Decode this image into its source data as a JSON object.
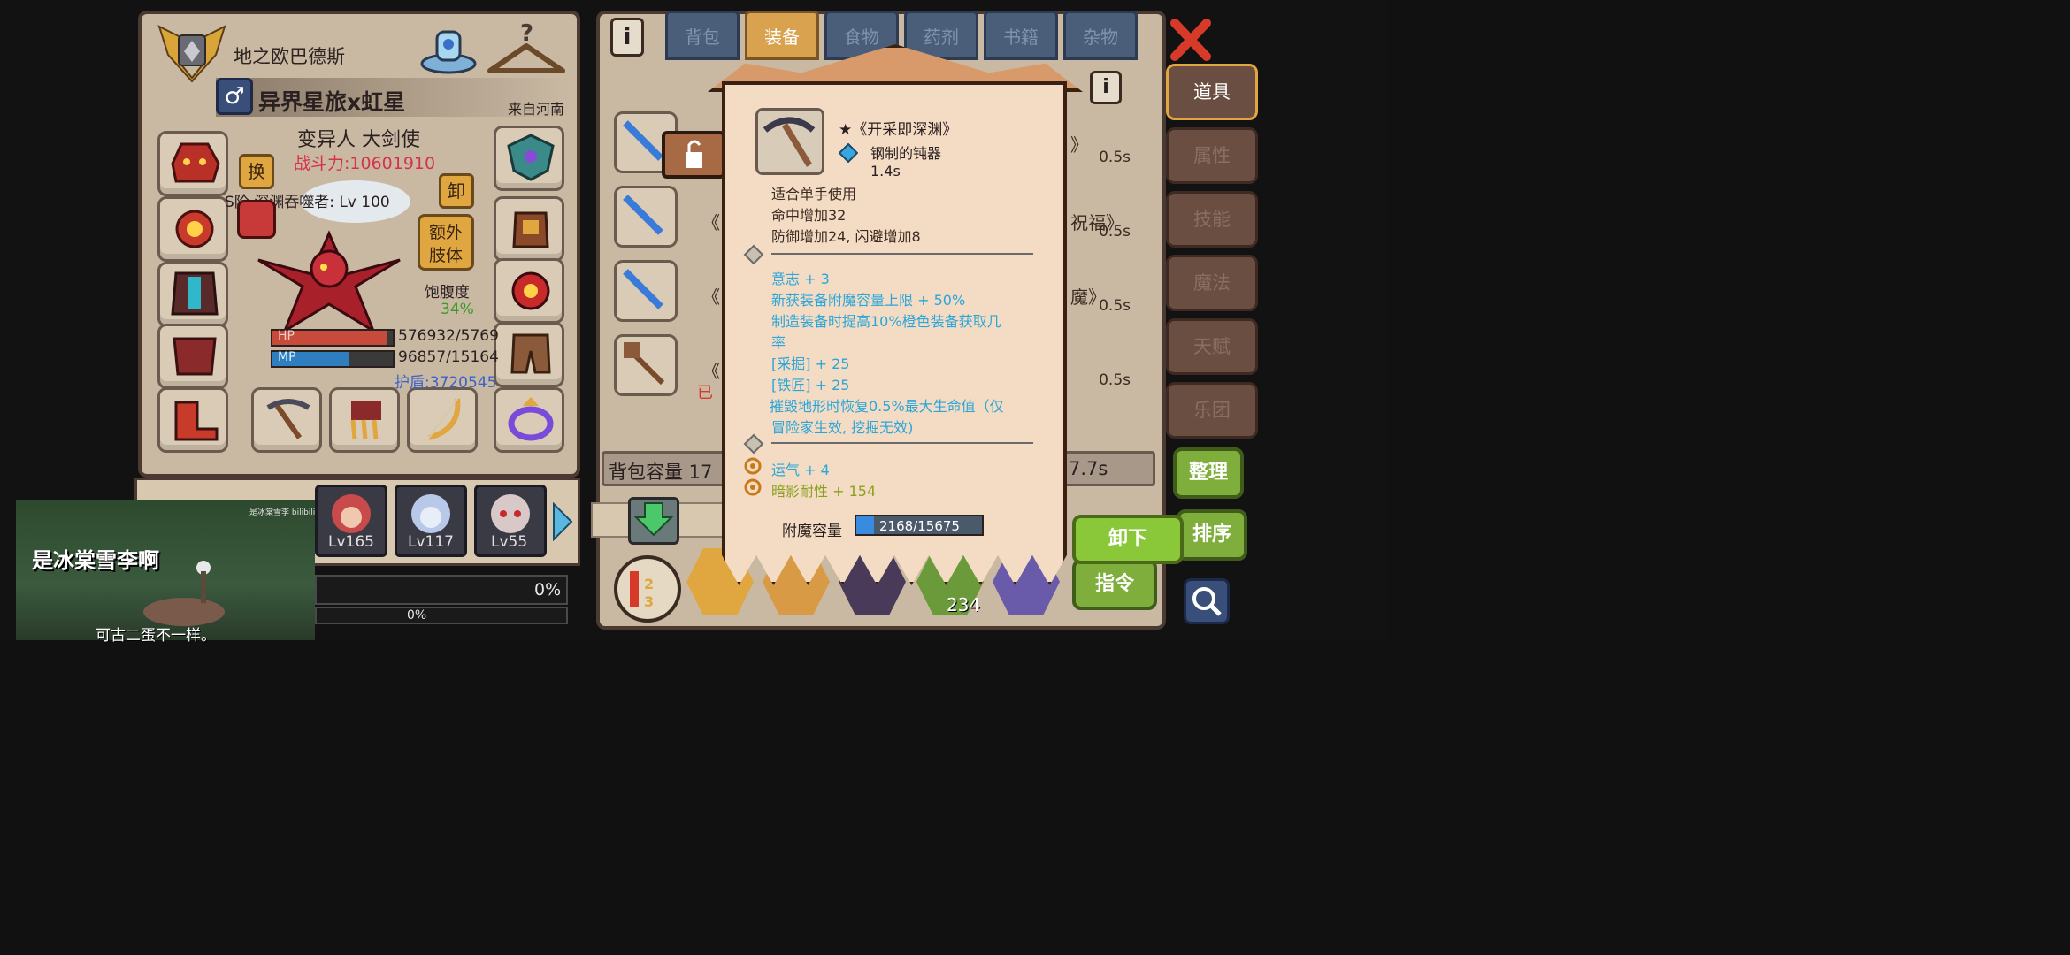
{
  "character": {
    "name": "地之欧巴德斯",
    "title": "异界星旅x虹星",
    "origin": "来自河南",
    "class": "变异人 大剑使",
    "power": "战斗力:10601910",
    "swap_label": "换",
    "unequip_label": "卸",
    "skill": "S阶 深渊吞噬者: Lv 100",
    "extra_limb_label": "额外\n肢体",
    "satiety_label": "饱腹度",
    "satiety_value": "34%",
    "hp_label": "HP",
    "hp_value": "576932/5769",
    "hp_fraction": 0.95,
    "mp_label": "MP",
    "mp_value": "96857/15164",
    "mp_fraction": 0.64,
    "shield": "护盾:3720545"
  },
  "party": [
    {
      "level": "Lv165"
    },
    {
      "level": "Lv117"
    },
    {
      "level": "Lv55"
    }
  ],
  "progress": {
    "top_value": "0%",
    "bottom_value": "0%"
  },
  "tabs": [
    "背包",
    "装备",
    "食物",
    "药剂",
    "书籍",
    "杂物"
  ],
  "active_tab": "装备",
  "side_menu": [
    "道具",
    "属性",
    "技能",
    "魔法",
    "天赋",
    "乐团"
  ],
  "inventory": {
    "rows": [
      {
        "partial_name": "《",
        "time": "0.5s",
        "extra": "》"
      },
      {
        "partial_name": "《",
        "time": "0.5s",
        "extra": "祝福》"
      },
      {
        "partial_name": "《",
        "time": "0.5s",
        "extra": "魔》"
      },
      {
        "partial_name": "《",
        "time": "0.5s",
        "extra": ""
      }
    ],
    "equipped_tag": "已",
    "capacity_label": "背包容量 17",
    "timer": "7.7s"
  },
  "buttons": {
    "sort": "整理",
    "order": "排序",
    "command": "指令",
    "unequip": "卸下"
  },
  "hotbar_count": "234",
  "tooltip": {
    "name": "★《开采即深渊》",
    "type": "钢制的钝器",
    "speed": "1.4s",
    "lines": [
      {
        "text": "适合单手使用",
        "color": "dark"
      },
      {
        "text": "命中增加32",
        "color": "dark"
      },
      {
        "text": "防御增加24, 闪避增加8",
        "color": "dark"
      },
      {
        "text": "意志 + 3",
        "color": "blue"
      },
      {
        "text": "新获装备附魔容量上限 + 50%",
        "color": "blue"
      },
      {
        "text": "制造装备时提高10%橙色装备获取几",
        "color": "blue"
      },
      {
        "text": "率",
        "color": "blue"
      },
      {
        "text": "[采掘] + 25",
        "color": "blue"
      },
      {
        "text": "[铁匠] + 25",
        "color": "blue"
      },
      {
        "text": "摧毁地形时恢复0.5%最大生命值（仅",
        "color": "blue"
      },
      {
        "text": "冒险家生效, 挖掘无效)",
        "color": "blue"
      },
      {
        "text": "运气 + 4",
        "color": "blue"
      },
      {
        "text": "暗影耐性 + 154",
        "color": "green"
      }
    ],
    "enchant_label": "附魔容量",
    "enchant_value": "2168/15675",
    "enchant_fraction": 0.14
  },
  "overlay": {
    "watermark": "是冰棠雪李啊",
    "subtitle": "可古二蛋不一样。",
    "bili_tag": "是冰棠雪李 bilibili"
  },
  "colors": {
    "power_red": "#d6334a",
    "satiety_green": "#3b9a2a",
    "hp_red": "#c84a3a",
    "mp_blue": "#2f7fc0",
    "shield_blue": "#3a62c9",
    "stat_blue": "#2aa6d9",
    "stat_green": "#8aa020",
    "tab_active": "#d9a24e"
  }
}
